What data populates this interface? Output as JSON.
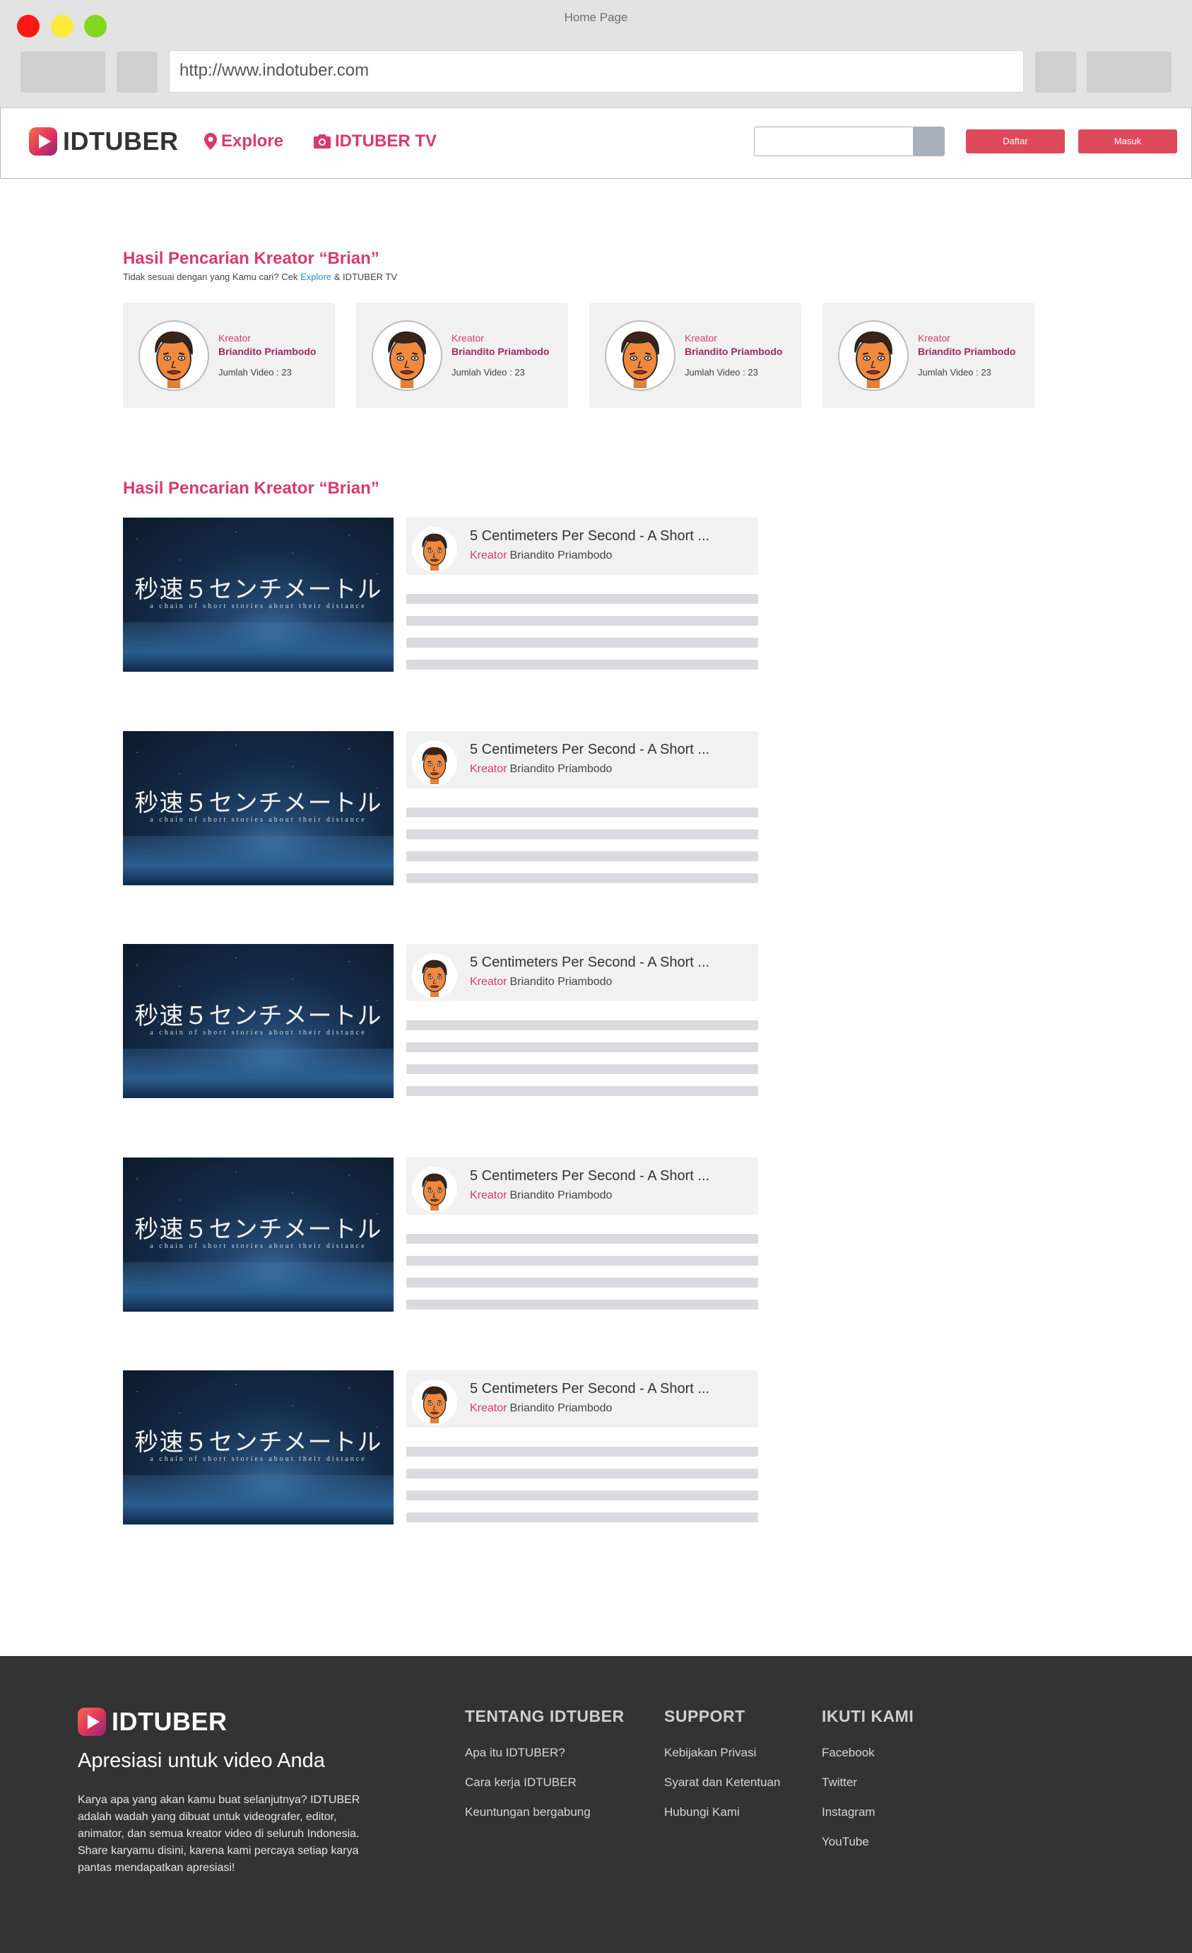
{
  "window": {
    "title": "Home Page",
    "url": "http://www.indotuber.com"
  },
  "nav": {
    "brand": "IDTUBER",
    "explore": "Explore",
    "tv": "IDTUBER TV",
    "search_placeholder": "",
    "daftar": "Daftar",
    "masuk": "Masuk"
  },
  "creators_section": {
    "title": "Hasil Pencarian Kreator “Brian”",
    "subtitle_prefix": "Tidak sesuai dengan yang Kamu cari?  Cek ",
    "subtitle_link": "Explore",
    "subtitle_suffix": " & IDTUBER TV",
    "cards": [
      {
        "role": "Kreator",
        "name": "Briandito Priambodo",
        "count": "Jumlah Video : 23"
      },
      {
        "role": "Kreator",
        "name": "Briandito Priambodo",
        "count": "Jumlah Video : 23"
      },
      {
        "role": "Kreator",
        "name": "Briandito Priambodo",
        "count": "Jumlah Video : 23"
      },
      {
        "role": "Kreator",
        "name": "Briandito Priambodo",
        "count": "Jumlah Video : 23"
      }
    ]
  },
  "videos_section": {
    "title": "Hasil Pencarian Kreator “Brian”",
    "thumb_title_jp": "秒速５センチメートル",
    "thumb_subtitle": "a chain of short stories about their distance",
    "items": [
      {
        "title": "5 Centimeters Per Second - A Short ...",
        "creator_label": "Kreator",
        "creator": "Briandito Priambodo"
      },
      {
        "title": "5 Centimeters Per Second - A Short ...",
        "creator_label": "Kreator",
        "creator": "Briandito Priambodo"
      },
      {
        "title": "5 Centimeters Per Second - A Short ...",
        "creator_label": "Kreator",
        "creator": "Briandito Priambodo"
      },
      {
        "title": "5 Centimeters Per Second - A Short ...",
        "creator_label": "Kreator",
        "creator": "Briandito Priambodo"
      },
      {
        "title": "5 Centimeters Per Second - A Short ...",
        "creator_label": "Kreator",
        "creator": "Briandito Priambodo"
      }
    ]
  },
  "footer": {
    "brand": "IDTUBER",
    "tagline": "Apresiasi untuk video Anda",
    "description": "Karya apa yang akan kamu buat selanjutnya? IDTUBER adalah wadah yang dibuat untuk videografer, editor, animator, dan semua kreator video di seluruh Indonesia.  Share karyamu disini, karena kami percaya setiap karya pantas mendapatkan apresiasi!",
    "col1": {
      "heading": "TENTANG IDTUBER",
      "links": [
        "Apa itu IDTUBER?",
        "Cara kerja IDTUBER",
        "Keuntungan bergabung"
      ]
    },
    "col2": {
      "heading": "SUPPORT",
      "links": [
        "Kebijakan Privasi",
        "Syarat dan Ketentuan",
        "Hubungi Kami"
      ]
    },
    "col3": {
      "heading": "IKUTI KAMI",
      "links": [
        "Facebook",
        "Twitter",
        "Instagram",
        "YouTube"
      ]
    }
  },
  "colors": {
    "brand": "#d63c69",
    "button": "#df4a5b",
    "link": "#2e8ed8",
    "footer_bg": "#333333"
  }
}
